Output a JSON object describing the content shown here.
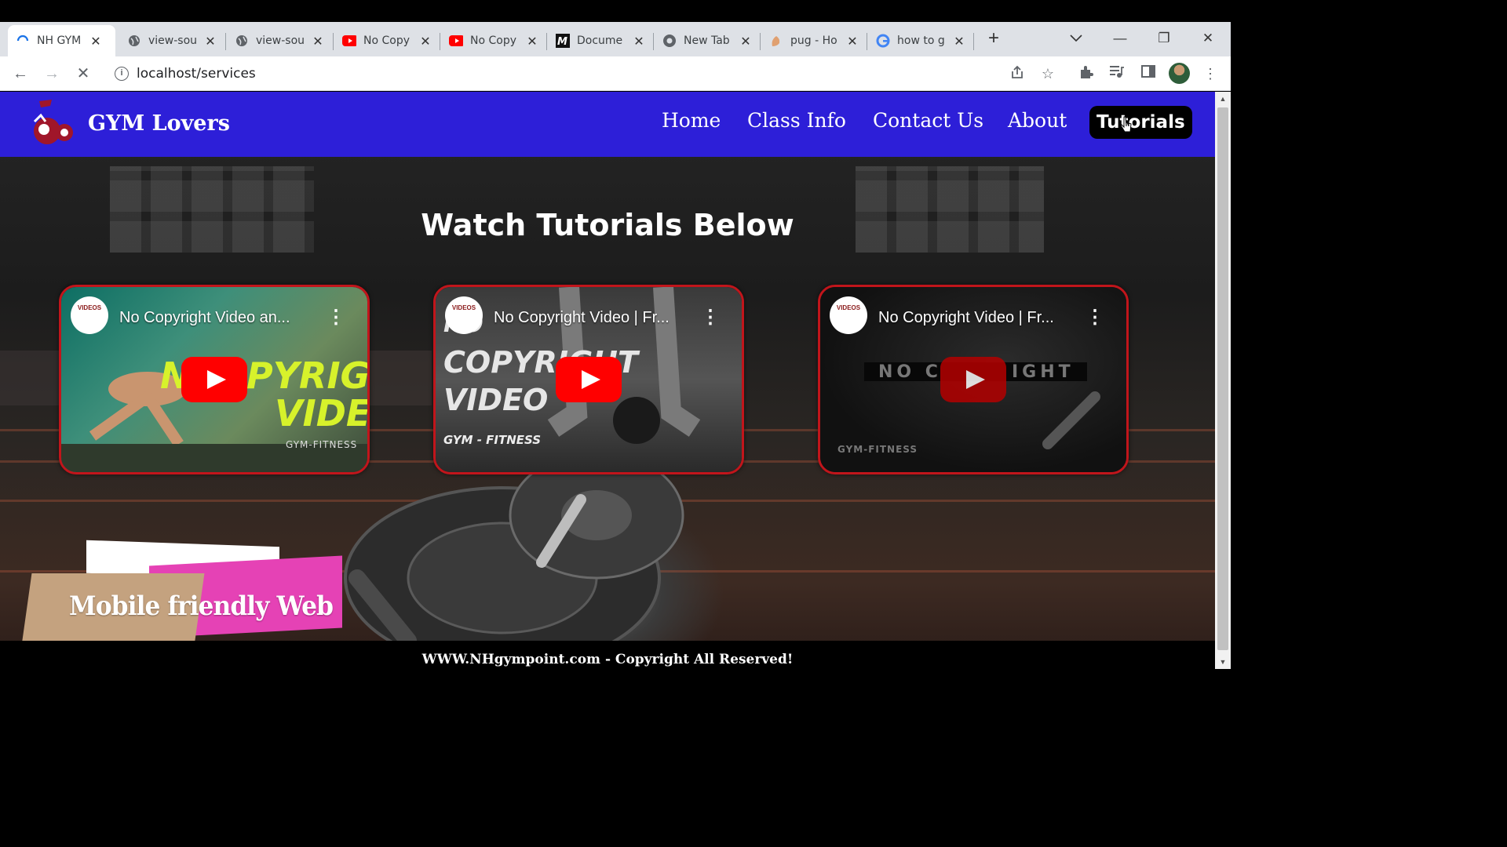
{
  "browser": {
    "tabs": [
      {
        "label": "NH GYM",
        "icon": "loading-spinner-icon",
        "active": true
      },
      {
        "label": "view-sou",
        "icon": "globe-icon"
      },
      {
        "label": "view-sou",
        "icon": "globe-icon"
      },
      {
        "label": "No Copy",
        "icon": "youtube-icon"
      },
      {
        "label": "No Copy",
        "icon": "youtube-icon"
      },
      {
        "label": "Docume",
        "icon": "document-m-icon"
      },
      {
        "label": "New Tab",
        "icon": "chrome-icon"
      },
      {
        "label": "pug - Ho",
        "icon": "pug-icon"
      },
      {
        "label": "how to g",
        "icon": "google-icon"
      }
    ],
    "url": "localhost/services"
  },
  "site": {
    "brand": "GYM Lovers",
    "nav": [
      "Home",
      "Class Info",
      "Contact Us",
      "About",
      "Tutorials"
    ],
    "heading": "Watch Tutorials Below",
    "videos": [
      {
        "title": "No Copyright Video an...",
        "channel": "VIDEOS",
        "thumb_big_1": "N",
        "thumb_big_2": "PYRIGHT",
        "thumb_big_3": "VIDEO",
        "thumb_small": "GYM-FITNESS"
      },
      {
        "title": "No Copyright Video | Fr...",
        "channel": "VIDEOS",
        "thumb_big_1": "NO",
        "thumb_big_2": "COPYRIGHT",
        "thumb_big_3": "VIDEO",
        "thumb_small": "GYM - FITNESS"
      },
      {
        "title": "No Copyright Video | Fr...",
        "channel": "VIDEOS",
        "thumb_big_1": "NO C",
        "thumb_big_2": "IGHT",
        "thumb_small": "GYM-FITNESS"
      }
    ],
    "banner": "Mobile friendly Web",
    "footer": "WWW.NHgympoint.com - Copyright All Reserved!"
  },
  "colors": {
    "navbar": "#2d1fd8",
    "video_border": "#c1151b",
    "banner_pink": "#e542b5",
    "banner_tan": "#c4a27f"
  }
}
